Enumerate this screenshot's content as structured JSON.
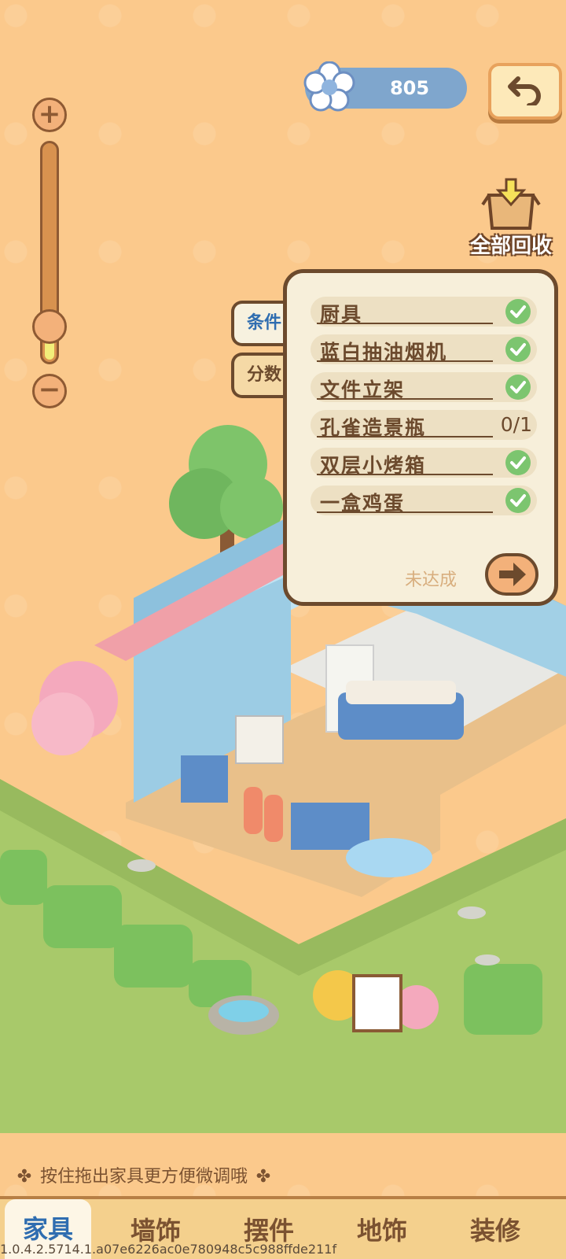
{
  "currency": {
    "value": "805",
    "icon": "flower-icon"
  },
  "top_right": {
    "back_icon": "undo-arrow-icon"
  },
  "zoom": {
    "plus": "+",
    "minus": "−",
    "level": 0.1
  },
  "recycle_all": {
    "label": "全部回收",
    "icon": "box-arrow-icon"
  },
  "side_tabs": [
    {
      "label": "条件",
      "active": true
    },
    {
      "label": "分数",
      "active": false
    }
  ],
  "conditions": [
    {
      "name": "厨具",
      "done": true
    },
    {
      "name": "蓝白抽油烟机",
      "done": true
    },
    {
      "name": "文件立架",
      "done": true
    },
    {
      "name": "孔雀造景瓶",
      "done": false,
      "progress": "0/1"
    },
    {
      "name": "双层小烤箱",
      "done": true
    },
    {
      "name": "一盒鸡蛋",
      "done": true
    }
  ],
  "panel": {
    "status": "未达成",
    "next_icon": "arrow-right-icon"
  },
  "hint": {
    "text": "按住拖出家具更方便微调哦",
    "icon": "flower-icon"
  },
  "bottom_tabs": [
    {
      "label": "家具",
      "active": true
    },
    {
      "label": "墙饰",
      "active": false
    },
    {
      "label": "摆件",
      "active": false
    },
    {
      "label": "地饰",
      "active": false
    },
    {
      "label": "装修",
      "active": false
    }
  ],
  "version": "1.0.4.2.5714.1.a07e6226ac0e780948c5c988ffde211f",
  "colors": {
    "accent": "#2f6db0",
    "brown": "#6c4a2d",
    "bg": "#fbc98c",
    "check": "#7cc56f"
  }
}
